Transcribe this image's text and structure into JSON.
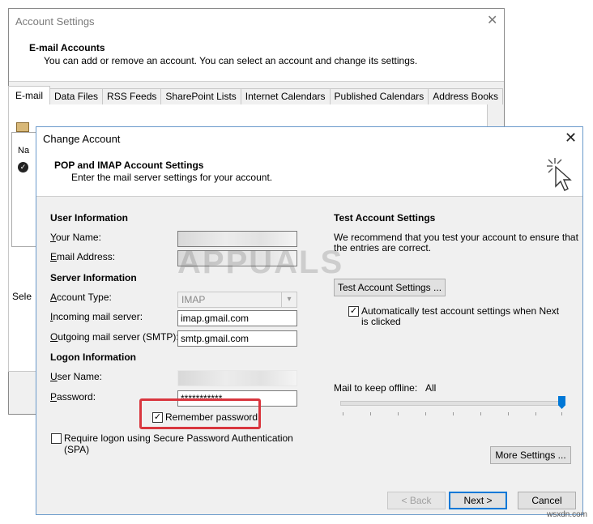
{
  "account_settings": {
    "title": "Account Settings",
    "header_title": "E-mail Accounts",
    "header_desc": "You can add or remove an account. You can select an account and change its settings.",
    "tabs": [
      "E-mail",
      "Data Files",
      "RSS Feeds",
      "SharePoint Lists",
      "Internet Calendars",
      "Published Calendars",
      "Address Books"
    ],
    "list_header_fragment": "Na",
    "select_fragment": "Sele"
  },
  "dialog": {
    "title": "Change Account",
    "header_title": "POP and IMAP Account Settings",
    "header_desc": "Enter the mail server settings for your account."
  },
  "left": {
    "user_info_title": "User Information",
    "your_name_label": "Your Name:",
    "email_label": "Email Address:",
    "server_info_title": "Server Information",
    "account_type_label": "Account Type:",
    "account_type_value": "IMAP",
    "incoming_label": "Incoming mail server:",
    "incoming_value": "imap.gmail.com",
    "outgoing_label": "Outgoing mail server (SMTP):",
    "outgoing_value": "smtp.gmail.com",
    "logon_info_title": "Logon Information",
    "username_label": "User Name:",
    "password_label": "Password:",
    "password_value": "***********",
    "remember_password_label": "Remember password",
    "remember_password_checked": true,
    "spa_label_line1": "Require logon using Secure Password Authentication",
    "spa_label_line2": "(SPA)",
    "spa_checked": false
  },
  "right": {
    "test_title": "Test Account Settings",
    "test_desc_line1": "We recommend that you test your account to ensure that",
    "test_desc_line2": "the entries are correct.",
    "test_button": "Test Account Settings ...",
    "auto_test_line1": "Automatically test account settings when Next",
    "auto_test_line2": "is clicked",
    "auto_test_checked": true,
    "offline_label": "Mail to keep offline:",
    "offline_value": "All",
    "offline_slider_fraction": 1.0,
    "more_settings_button": "More Settings ..."
  },
  "footer": {
    "back_button": "< Back",
    "next_button": "Next >",
    "cancel_button": "Cancel"
  },
  "watermark": {
    "brand": "APPUALS",
    "source": "wsxdn.com"
  },
  "colors": {
    "highlight_box": "#d9363e",
    "accent": "#0078d7",
    "dialog_bg": "#f0f0f0"
  }
}
